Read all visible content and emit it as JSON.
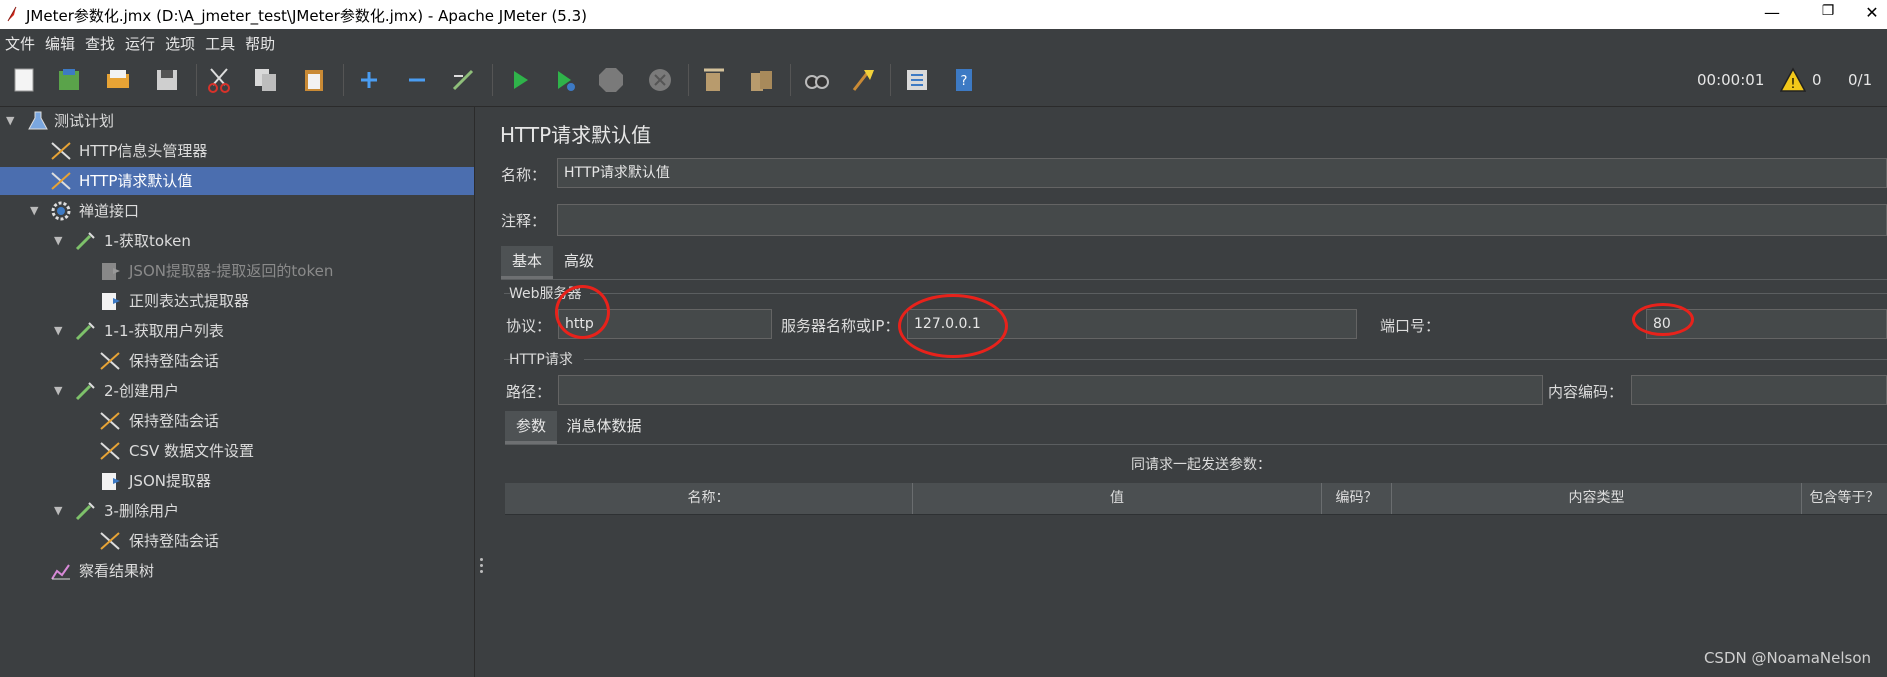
{
  "window": {
    "title": "JMeter参数化.jmx (D:\\A_jmeter_test\\JMeter参数化.jmx) - Apache JMeter (5.3)",
    "minimize_glyph": "—",
    "restore_glyph": "❐",
    "close_glyph": "✕"
  },
  "menu": [
    "文件",
    "编辑",
    "查找",
    "运行",
    "选项",
    "工具",
    "帮助"
  ],
  "toolbar": {
    "timer": "00:00:01",
    "warnings": "0",
    "threads": "0/1",
    "icons": [
      "new-icon",
      "templates-icon",
      "open-icon",
      "save-icon",
      "cut-icon",
      "copy-icon",
      "paste-icon",
      "expand-icon",
      "collapse-icon",
      "toggle-icon",
      "start-icon",
      "start-no-pause-icon",
      "stop-icon",
      "shutdown-icon",
      "clear-icon",
      "clear-all-icon",
      "search-icon",
      "reset-search-icon",
      "function-helper-icon",
      "help-icon"
    ]
  },
  "tree": [
    {
      "label": "测试计划",
      "icon": "flask-icon"
    },
    {
      "label": "HTTP信息头管理器",
      "icon": "wrench-icon"
    },
    {
      "label": "HTTP请求默认值",
      "icon": "wrench-icon"
    },
    {
      "label": "禅道接口",
      "icon": "gear-icon"
    },
    {
      "label": "1-获取token",
      "icon": "pipette-icon"
    },
    {
      "label": "JSON提取器-提取返回的token",
      "icon": "postprocessor-icon"
    },
    {
      "label": "正则表达式提取器",
      "icon": "postprocessor-icon"
    },
    {
      "label": "1-1-获取用户列表",
      "icon": "pipette-icon"
    },
    {
      "label": "保持登陆会话",
      "icon": "wrench-icon"
    },
    {
      "label": "2-创建用户",
      "icon": "pipette-icon"
    },
    {
      "label": "保持登陆会话",
      "icon": "wrench-icon"
    },
    {
      "label": "CSV 数据文件设置",
      "icon": "wrench-icon"
    },
    {
      "label": "JSON提取器",
      "icon": "postprocessor-icon"
    },
    {
      "label": "3-删除用户",
      "icon": "pipette-icon"
    },
    {
      "label": "保持登陆会话",
      "icon": "wrench-icon"
    },
    {
      "label": "察看结果树",
      "icon": "chart-icon"
    }
  ],
  "panel": {
    "title": "HTTP请求默认值",
    "name_label": "名称：",
    "name_value": "HTTP请求默认值",
    "comment_label": "注释：",
    "comment_value": "",
    "tabs": [
      "基本",
      "高级"
    ],
    "web_server_section": "Web服务器",
    "protocol_label": "协议：",
    "protocol_value": "http",
    "server_label": "服务器名称或IP：",
    "server_value": "127.0.0.1",
    "port_label": "端口号：",
    "port_value": "80",
    "http_request_section": "HTTP请求",
    "path_label": "路径：",
    "path_value": "",
    "encoding_label": "内容编码：",
    "encoding_value": "",
    "subtabs": [
      "参数",
      "消息体数据"
    ],
    "params_caption": "同请求一起发送参数：",
    "columns": [
      "名称：",
      "值",
      "编码？",
      "内容类型",
      "包含等于？"
    ]
  },
  "watermark": "CSDN @NoamaNelson",
  "colors": {
    "background": "#3c3f41",
    "selection": "#4b6eaf",
    "annotation_red": "#e8221b"
  }
}
